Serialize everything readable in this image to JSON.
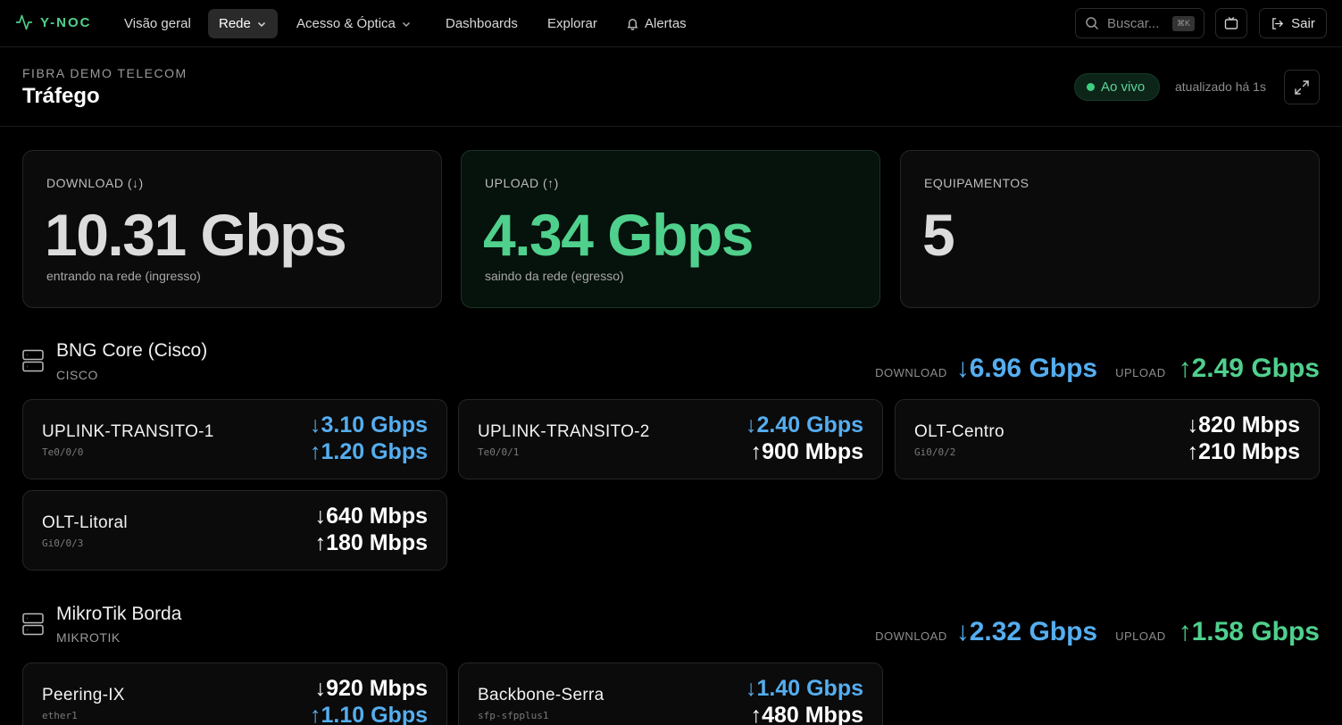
{
  "nav": {
    "logo": "Y-NOC",
    "items": [
      {
        "label": "Visão geral"
      },
      {
        "label": "Rede"
      },
      {
        "label": "Acesso & Óptica"
      },
      {
        "label": "Dashboards"
      },
      {
        "label": "Explorar"
      },
      {
        "label": "Alertas"
      }
    ],
    "search_placeholder": "Buscar...",
    "search_shortcut": "⌘K",
    "logout_label": "Sair"
  },
  "header": {
    "org": "FIBRA DEMO TELECOM",
    "title": "Tráfego",
    "live_label": "Ao vivo",
    "updated": "atualizado há 1s"
  },
  "stats": [
    {
      "label": "DOWNLOAD (↓)",
      "value": "10.31 Gbps",
      "sub": "entrando na rede (ingresso)"
    },
    {
      "label": "UPLOAD (↑)",
      "value": "4.34 Gbps",
      "sub": "saindo da rede (egresso)"
    },
    {
      "label": "EQUIPAMENTOS",
      "value": "5",
      "sub": ""
    }
  ],
  "devices": [
    {
      "name": "BNG Core (Cisco)",
      "vendor": "CISCO",
      "download_label": "DOWNLOAD",
      "download": "↓6.96 Gbps",
      "upload_label": "UPLOAD",
      "upload": "↑2.49 Gbps",
      "interfaces": [
        {
          "name": "UPLINK-TRANSITO-1",
          "port": "Te0/0/0",
          "down": "↓3.10 Gbps",
          "up": "↑1.20 Gbps"
        },
        {
          "name": "UPLINK-TRANSITO-2",
          "port": "Te0/0/1",
          "down": "↓2.40 Gbps",
          "up": "↑900 Mbps"
        },
        {
          "name": "OLT-Centro",
          "port": "Gi0/0/2",
          "down": "↓820 Mbps",
          "up": "↑210 Mbps"
        },
        {
          "name": "OLT-Litoral",
          "port": "Gi0/0/3",
          "down": "↓640 Mbps",
          "up": "↑180 Mbps"
        }
      ]
    },
    {
      "name": "MikroTik Borda",
      "vendor": "MIKROTIK",
      "download_label": "DOWNLOAD",
      "download": "↓2.32 Gbps",
      "upload_label": "UPLOAD",
      "upload": "↑1.58 Gbps",
      "interfaces": [
        {
          "name": "Peering-IX",
          "port": "ether1",
          "down": "↓920 Mbps",
          "up": "↑1.10 Gbps"
        },
        {
          "name": "Backbone-Serra",
          "port": "sfp-sfpplus1",
          "down": "↓1.40 Gbps",
          "up": "↑480 Mbps"
        }
      ]
    }
  ],
  "colors": {
    "accent_green": "#4fd08c",
    "accent_blue": "#55aef0",
    "background": "#000000"
  }
}
